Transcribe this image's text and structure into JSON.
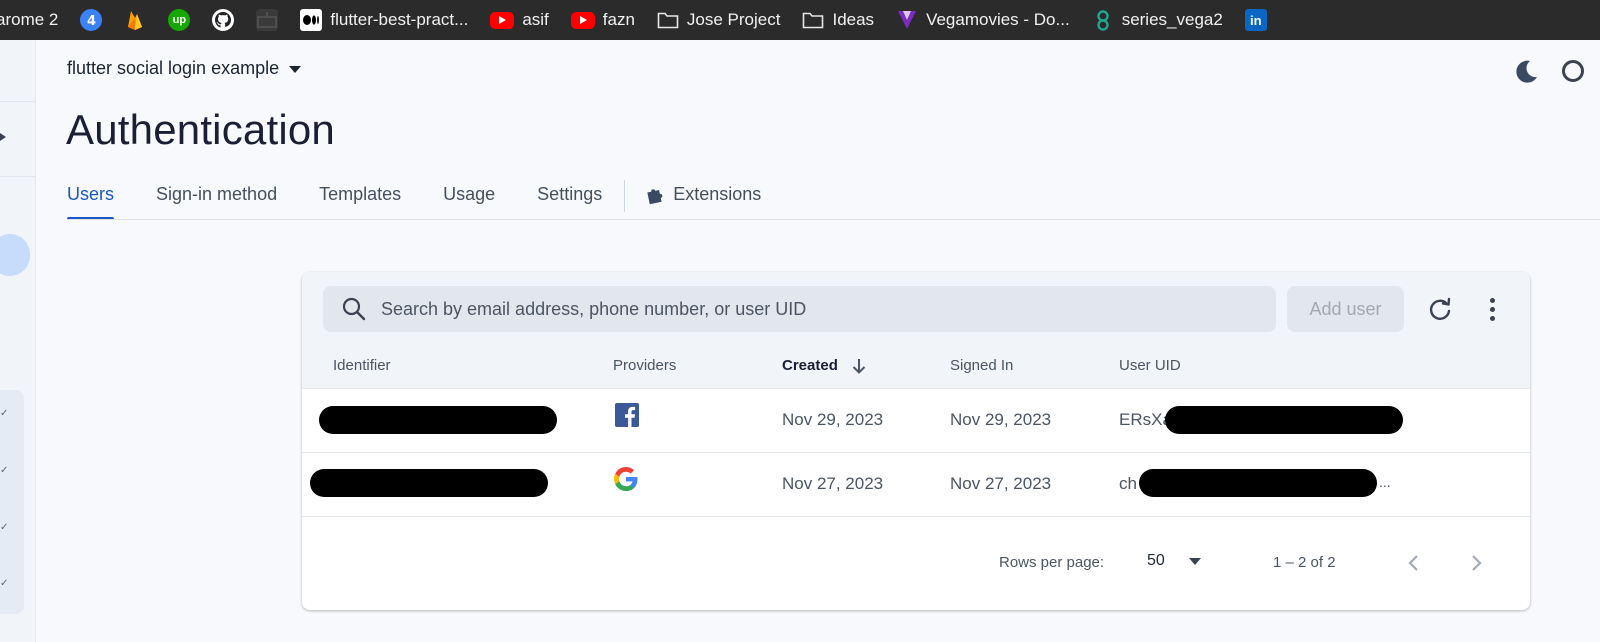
{
  "bookmarks": [
    {
      "label": "arome 2",
      "icon": "none"
    },
    {
      "label": "",
      "icon": "blue-4-icon"
    },
    {
      "label": "",
      "icon": "firebase-icon"
    },
    {
      "label": "",
      "icon": "upwork-icon"
    },
    {
      "label": "",
      "icon": "github-icon"
    },
    {
      "label": "",
      "icon": "dark-tab-icon"
    },
    {
      "label": "flutter-best-pract...",
      "icon": "medium-icon"
    },
    {
      "label": "asif",
      "icon": "youtube-icon"
    },
    {
      "label": "fazn",
      "icon": "youtube-icon"
    },
    {
      "label": "Jose Project",
      "icon": "folder-icon"
    },
    {
      "label": "Ideas",
      "icon": "folder-icon"
    },
    {
      "label": "Vegamovies - Do...",
      "icon": "vega-icon"
    },
    {
      "label": "series_vega2",
      "icon": "infinity-icon"
    },
    {
      "label": "",
      "icon": "linkedin-icon"
    }
  ],
  "header": {
    "project": "flutter social login example",
    "title": "Authentication"
  },
  "tabs": [
    {
      "label": "Users",
      "active": true
    },
    {
      "label": "Sign-in method",
      "active": false
    },
    {
      "label": "Templates",
      "active": false
    },
    {
      "label": "Usage",
      "active": false
    },
    {
      "label": "Settings",
      "active": false
    },
    {
      "label": "Extensions",
      "active": false
    }
  ],
  "users_table": {
    "search_placeholder": "Search by email address, phone number, or user UID",
    "add_user_label": "Add user",
    "columns": [
      "Identifier",
      "Providers",
      "Created",
      "Signed In",
      "User UID"
    ],
    "sorted_column": "Created",
    "rows": [
      {
        "provider": "facebook",
        "created": "Nov 29, 2023",
        "signed_in": "Nov 29, 2023",
        "uid_prefix": "ERsXa",
        "uid_suffix": ""
      },
      {
        "provider": "google",
        "created": "Nov 27, 2023",
        "signed_in": "Nov 27, 2023",
        "uid_prefix": "ch",
        "uid_suffix": "..."
      }
    ],
    "rows_per_page_label": "Rows per page:",
    "rows_per_page_value": "50",
    "page_range": "1 – 2 of 2"
  },
  "colors": {
    "accent": "#1a56c5",
    "facebook": "#3b5998",
    "bookmarks_bg": "#2b2b2b"
  }
}
